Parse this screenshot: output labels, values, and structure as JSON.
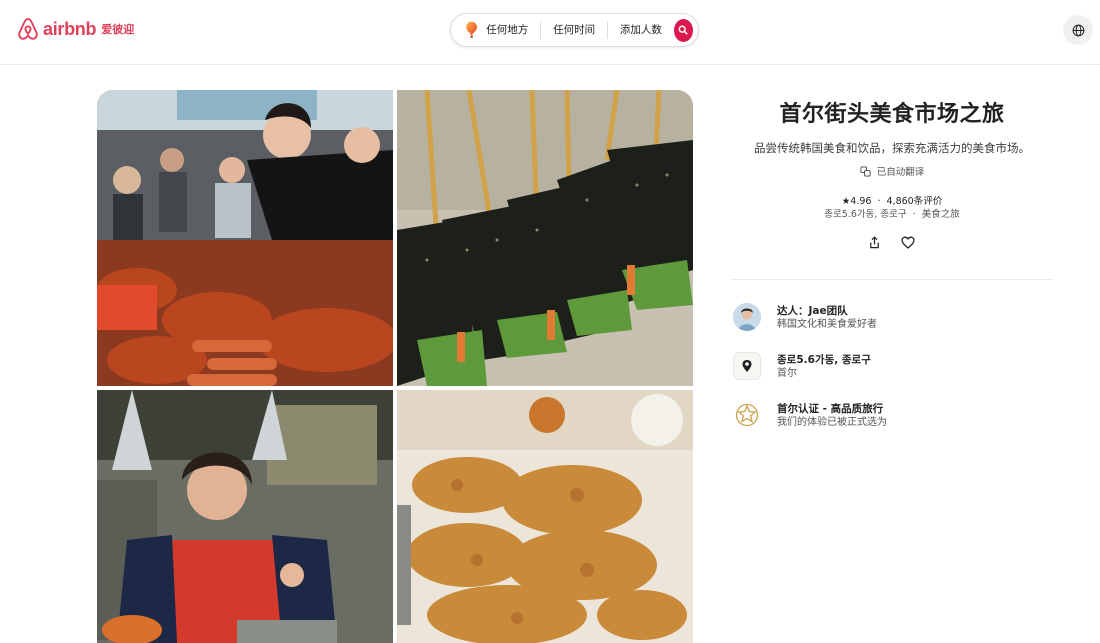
{
  "brand": {
    "wordmark": "airbnb",
    "region_label": "爱彼迎",
    "color": "#e0415a"
  },
  "search": {
    "where": "任何地方",
    "when": "任何时间",
    "guests": "添加人数",
    "button_color": "#dc184e"
  },
  "header_icons": [
    "globe-icon"
  ],
  "experience": {
    "title": "首尔街头美食市场之旅",
    "subtitle": "品尝传统韩国美食和饮品，探索充满活力的美食市场。",
    "translated_note": "已自动翻译",
    "rating": "★4.96",
    "rating_sep": "·",
    "reviews": "4,860条评价",
    "location": "종로5.6가동, 종로구",
    "category_sep": "·",
    "category": "美食之旅"
  },
  "actions": [
    "share-icon",
    "heart-icon"
  ],
  "details": [
    {
      "title": "达人：Jae团队",
      "subtitle": "韩国文化和美食爱好者",
      "icon": "host-avatar"
    },
    {
      "title": "종로5.6가동, 종로구",
      "subtitle": "首尔",
      "icon": "map-pin-icon"
    },
    {
      "title": "首尔认证 - 高品质旅行",
      "subtitle": "我们的体验已被正式选为",
      "icon": "seoul-badge-icon"
    }
  ]
}
